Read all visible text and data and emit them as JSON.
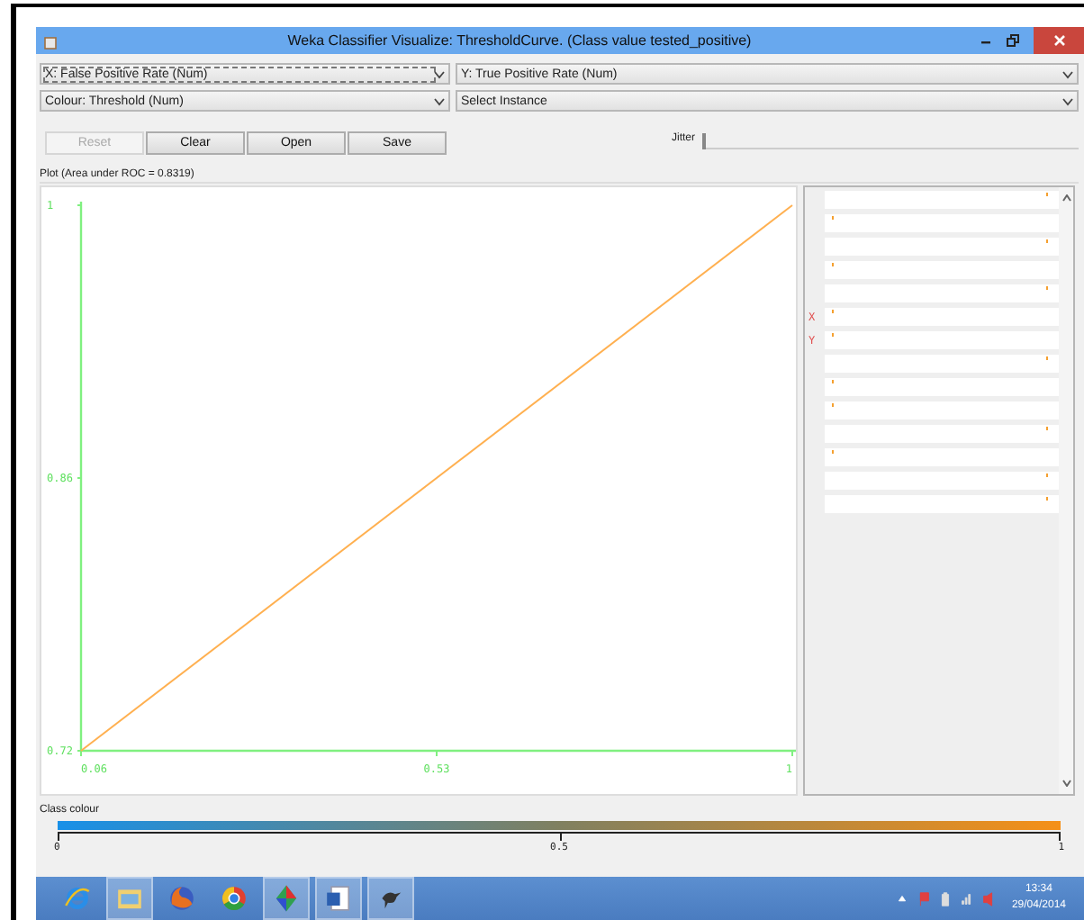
{
  "window": {
    "title": "Weka Classifier Visualize: ThresholdCurve. (Class value tested_positive)"
  },
  "selectors": [
    {
      "value": "X: False Positive Rate (Num)",
      "focused": true
    },
    {
      "value": "Y: True Positive Rate (Num)",
      "focused": false
    },
    {
      "value": "Colour: Threshold (Num)",
      "focused": false
    },
    {
      "value": "Select Instance",
      "focused": false
    }
  ],
  "buttons": [
    {
      "label": "Reset",
      "disabled": true
    },
    {
      "label": "Clear",
      "disabled": false
    },
    {
      "label": "Open",
      "disabled": false
    },
    {
      "label": "Save",
      "disabled": false
    }
  ],
  "jitter": {
    "label": "Jitter",
    "level": 0
  },
  "plot": {
    "title": "Plot (Area under ROC = 0.8319)",
    "chart_data": {
      "type": "line",
      "x": [
        0.06,
        1
      ],
      "series": [
        {
          "color": "#ffb050",
          "values": [
            0.72,
            1
          ]
        }
      ],
      "xlim": [
        0.06,
        1
      ],
      "ylim": [
        0.72,
        1
      ],
      "xticks": [
        {
          "value": 0.06,
          "label": "0.06"
        },
        {
          "value": 0.53,
          "label": "0.53"
        },
        {
          "value": 1,
          "label": "1"
        }
      ],
      "yticks": [
        {
          "value": 0.72,
          "label": "0.72"
        },
        {
          "value": 0.86,
          "label": "0.86"
        },
        {
          "value": 1,
          "label": "1"
        }
      ]
    }
  },
  "attribute_bars": [
    {
      "kind": "high"
    },
    {
      "kind": "low"
    },
    {
      "kind": "high"
    },
    {
      "kind": "low"
    },
    {
      "kind": "high"
    },
    {
      "kind": "low",
      "axis_label": "X"
    },
    {
      "kind": "low",
      "axis_label": "Y"
    },
    {
      "kind": "high"
    },
    {
      "kind": "low"
    },
    {
      "kind": "low"
    },
    {
      "kind": "high"
    },
    {
      "kind": "low"
    },
    {
      "kind": "high"
    },
    {
      "kind": "high"
    }
  ],
  "class_colour": {
    "title": "Class colour",
    "ticks": [
      "0",
      "0.5",
      "1"
    ]
  },
  "taskbar": {
    "apps": [
      {
        "kind": "browser",
        "active": false
      },
      {
        "kind": "folder",
        "active": true
      },
      {
        "kind": "globe",
        "active": false
      },
      {
        "kind": "wheel",
        "active": false
      },
      {
        "kind": "diamond",
        "active": true
      },
      {
        "kind": "document",
        "active": true
      },
      {
        "kind": "bird",
        "active": true
      }
    ],
    "clock": {
      "time": "13:34",
      "date": "29/04/2014"
    }
  }
}
